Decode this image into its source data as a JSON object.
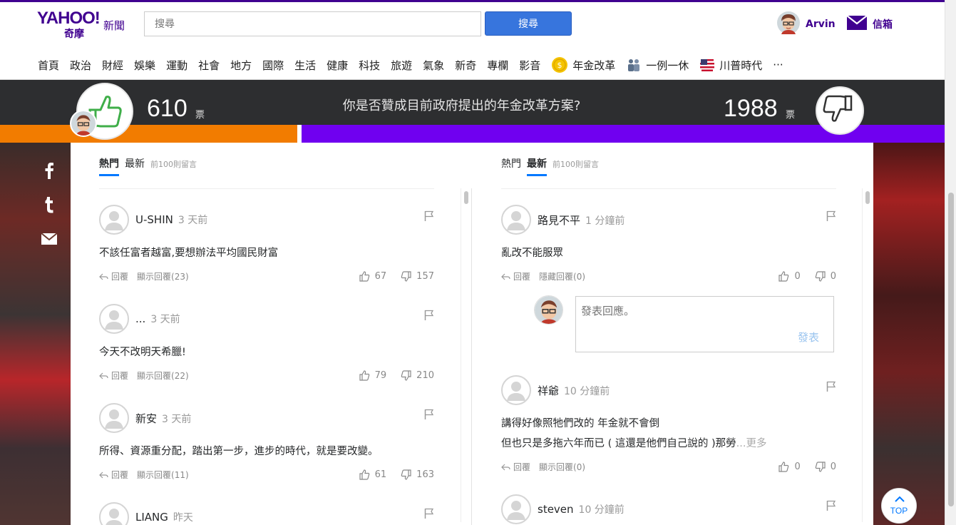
{
  "header": {
    "logo_text": "YAHOO!",
    "logo_sub": "奇摩",
    "section": "新聞",
    "search_placeholder": "搜尋",
    "search_button": "搜尋",
    "user_name": "Arvin",
    "mail_label": "信箱"
  },
  "nav": {
    "items": [
      "首頁",
      "政治",
      "財經",
      "娛樂",
      "運動",
      "社會",
      "地方",
      "國際",
      "生活",
      "健康",
      "科技",
      "旅遊",
      "氣象",
      "新奇",
      "專欄",
      "影音"
    ],
    "special": [
      "年金改革",
      "一例一休",
      "川普時代"
    ],
    "more": "···"
  },
  "vote": {
    "question": "你是否贊成目前政府提出的年金改革方案?",
    "yes_count": "610",
    "no_count": "1988",
    "unit": "票",
    "yes_share": 0.235,
    "colors": {
      "yes": "#f27c00",
      "no": "#7000f0"
    }
  },
  "left": {
    "tabs": {
      "hot": "熱門",
      "latest": "最新",
      "note": "前100則留言"
    },
    "comments": [
      {
        "name": "U-SHIN",
        "time": "3 天前",
        "body": [
          "不該任富者越富,要想辦法平均國民財富"
        ],
        "reply": "回覆",
        "show": "顯示回覆(23)",
        "up": "67",
        "down": "157"
      },
      {
        "name": "...",
        "time": "3 天前",
        "body": [
          "今天不改明天希臘!"
        ],
        "reply": "回覆",
        "show": "顯示回覆(22)",
        "up": "79",
        "down": "210"
      },
      {
        "name": "新安",
        "time": "3 天前",
        "body": [
          "所得、資源重分配，踏出第一步，進步的時代，就是要改變。"
        ],
        "reply": "回覆",
        "show": "顯示回覆(11)",
        "up": "61",
        "down": "163"
      },
      {
        "name": "LIANG",
        "time": "昨天"
      }
    ]
  },
  "right": {
    "tabs": {
      "hot": "熱門",
      "latest": "最新",
      "note": "前100則留言"
    },
    "comments": [
      {
        "name": "路見不平",
        "time": "1 分鐘前",
        "body": [
          "亂改不能服眾"
        ],
        "reply": "回覆",
        "show": "隱藏回覆(0)",
        "up": "0",
        "down": "0"
      },
      {
        "name": "祥爺",
        "time": "10 分鐘前",
        "body": [
          "講得好像照牠們改的 年金就不會倒",
          "但也只是多拖六年而已 ( 這還是他們自己說的 )那勞"
        ],
        "more": "...更多",
        "reply": "回覆",
        "show": "顯示回覆(0)",
        "up": "0",
        "down": "0"
      },
      {
        "name": "steven",
        "time": "10 分鐘前"
      }
    ],
    "reply_placeholder": "發表回應。",
    "reply_submit": "發表"
  },
  "top_button": "TOP"
}
